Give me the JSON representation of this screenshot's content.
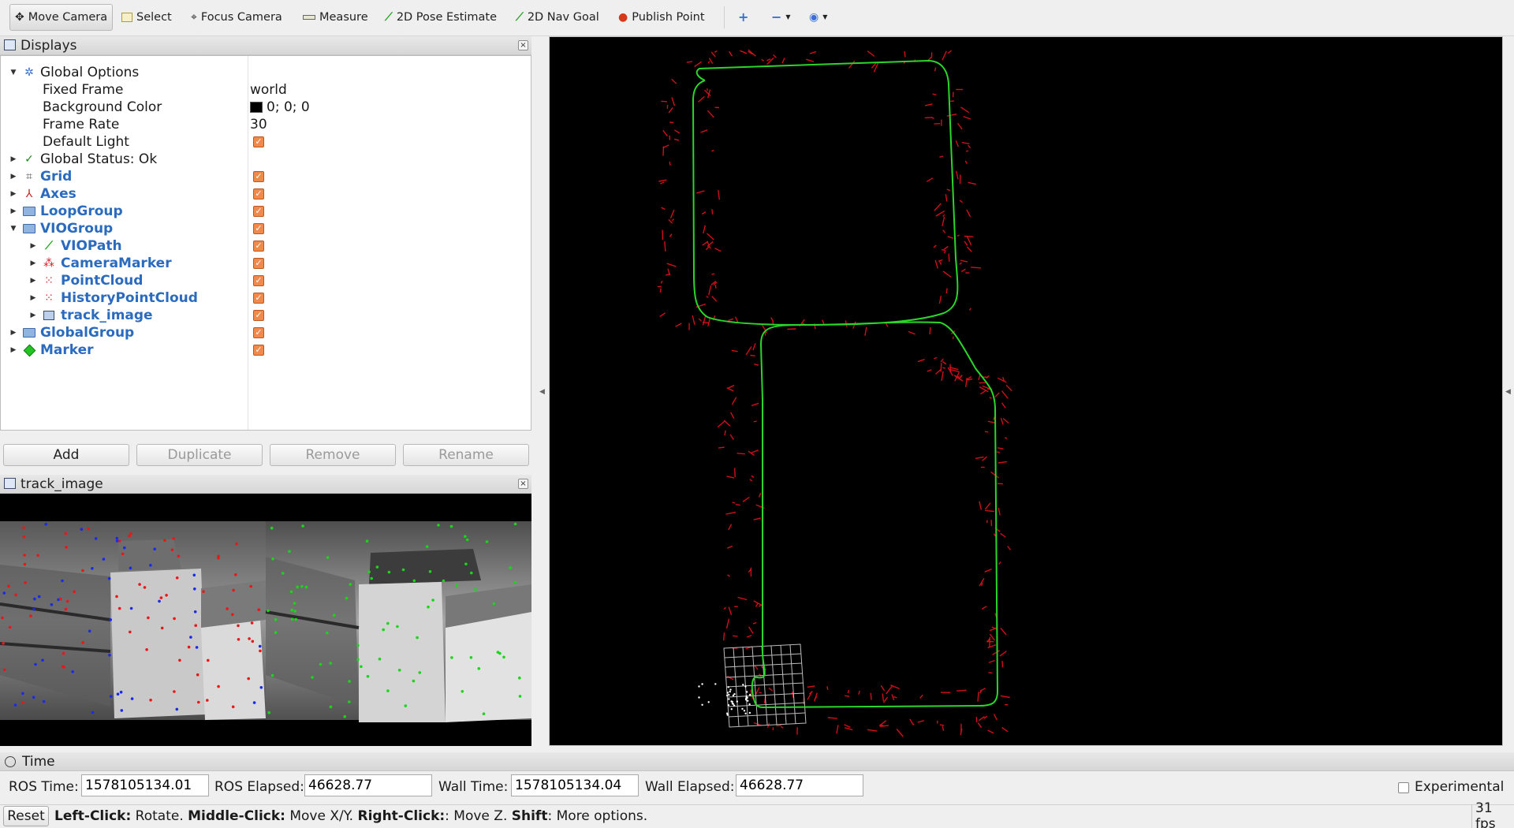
{
  "toolbar": {
    "tools": [
      {
        "id": "move-camera",
        "label": "Move Camera",
        "icon": "move-camera-icon",
        "active": true
      },
      {
        "id": "select",
        "label": "Select",
        "icon": "select-icon"
      },
      {
        "id": "focus-camera",
        "label": "Focus Camera",
        "icon": "focus-camera-icon"
      },
      {
        "id": "measure",
        "label": "Measure",
        "icon": "measure-icon"
      },
      {
        "id": "2d-pose-estimate",
        "label": "2D Pose Estimate",
        "icon": "pose-arrow-icon"
      },
      {
        "id": "2d-nav-goal",
        "label": "2D Nav Goal",
        "icon": "nav-goal-arrow-icon"
      },
      {
        "id": "publish-point",
        "label": "Publish Point",
        "icon": "map-pin-icon"
      }
    ],
    "extra_icons": [
      "plus-icon",
      "minus-icon",
      "eye-icon"
    ]
  },
  "displays_panel": {
    "title": "Displays",
    "global_options": {
      "label": "Global Options",
      "fixed_frame": {
        "label": "Fixed Frame",
        "value": "world"
      },
      "background_color": {
        "label": "Background Color",
        "value": "0; 0; 0",
        "color": "#000000"
      },
      "frame_rate": {
        "label": "Frame Rate",
        "value": "30"
      },
      "default_light": {
        "label": "Default Light",
        "checked": true
      }
    },
    "global_status": {
      "label": "Global Status: Ok"
    },
    "items": [
      {
        "label": "Grid",
        "checked": true
      },
      {
        "label": "Axes",
        "checked": true
      },
      {
        "label": "LoopGroup",
        "checked": true
      },
      {
        "label": "VIOGroup",
        "checked": true
      },
      {
        "label": "VIOPath",
        "checked": true
      },
      {
        "label": "CameraMarker",
        "checked": true
      },
      {
        "label": "PointCloud",
        "checked": true
      },
      {
        "label": "HistoryPointCloud",
        "checked": true
      },
      {
        "label": "track_image",
        "checked": true
      },
      {
        "label": "GlobalGroup",
        "checked": true
      },
      {
        "label": "Marker",
        "checked": true
      }
    ],
    "buttons": {
      "add": "Add",
      "duplicate": "Duplicate",
      "remove": "Remove",
      "rename": "Rename"
    }
  },
  "track_panel": {
    "title": "track_image"
  },
  "time_panel": {
    "title": "Time",
    "ros_time_label": "ROS Time:",
    "ros_time": "1578105134.01",
    "ros_elapsed_label": "ROS Elapsed:",
    "ros_elapsed": "46628.77",
    "wall_time_label": "Wall Time:",
    "wall_time": "1578105134.04",
    "wall_elapsed_label": "Wall Elapsed:",
    "wall_elapsed": "46628.77",
    "experimental_label": "Experimental",
    "experimental_checked": false
  },
  "status_bar": {
    "reset_label": "Reset",
    "help_parts": [
      {
        "bold": "Left-Click:",
        "text": " Rotate. "
      },
      {
        "bold": "Middle-Click:",
        "text": " Move X/Y. "
      },
      {
        "bold": "Right-Click:",
        "text": ": Move Z. "
      },
      {
        "bold": "Shift",
        "text": ": More options."
      }
    ],
    "fps": "31 fps"
  },
  "colors": {
    "path": "#2bd62b",
    "features": "#e0101c",
    "background_3d": "#000000",
    "checkbox": "#f08a4b",
    "tree_link": "#2a6bbf"
  }
}
